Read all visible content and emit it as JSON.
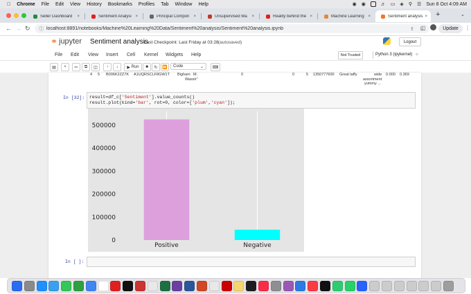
{
  "menubar": {
    "items": [
      "Chrome",
      "File",
      "Edit",
      "View",
      "History",
      "Bookmarks",
      "Profiles",
      "Tab",
      "Window",
      "Help"
    ],
    "clock": "Sun 8 Oct  4:09 AM"
  },
  "tabs": [
    {
      "title": "Seller Dashboard",
      "color": "#2b8a3e"
    },
    {
      "title": "Sentiment Analysi",
      "color": "#e02020"
    },
    {
      "title": "Principal Compon",
      "color": "#666666"
    },
    {
      "title": "Unsupervised Ma",
      "color": "#c0392b"
    },
    {
      "title": "Reality behind the",
      "color": "#e02020"
    },
    {
      "title": "Machine Learning",
      "color": "#e08a3c"
    },
    {
      "title": "Sentiment analysis",
      "color": "#f37626"
    }
  ],
  "address": {
    "url": "localhost:8891/notebooks/Machine%20Learning%20Data/Sentiment%20analysis/Sentiment%20analysis.ipynb",
    "update": "Update"
  },
  "jupyter": {
    "logo": "jupyter",
    "notebook_name": "Sentiment analysis",
    "checkpoint": "Last Checkpoint: Last Friday at 03:28",
    "autosave": "(autosaved)",
    "logout": "Logout",
    "trusted": "Not Trusted",
    "kernel": "Python 3 (ipykernel)",
    "menu": [
      "File",
      "Edit",
      "View",
      "Insert",
      "Cell",
      "Kernel",
      "Widgets",
      "Help"
    ],
    "run": "Run",
    "celltype": "Code"
  },
  "partial_row": {
    "index": "4",
    "col1": "5",
    "id": "B006K2ZZ7K",
    "user": "A1UQRSCLF8GW1T",
    "name1": "Bigham",
    "name2": "M.",
    "name3": "Wassir\"",
    "v1": "0",
    "v2": "0",
    "v3": "5",
    "time": "1350777600",
    "summary": "Great taffy",
    "text1": "wide",
    "text2": "assortment",
    "text3": "yummy ...",
    "n1": "0.000",
    "n2": "0.369"
  },
  "cell32": {
    "prompt": "In [32]:",
    "line1_a": "result=df_c[",
    "line1_s": "'Sentiment'",
    "line1_b": "].value_counts()",
    "line2_a": "result.plot(kind=",
    "line2_s1": "'bar'",
    "line2_b": ", rot=0, color=[",
    "line2_s2": "'plum'",
    "line2_c": ",",
    "line2_s3": "'cyan'",
    "line2_d": "]);"
  },
  "empty_cell": {
    "prompt": "In [ ]:"
  },
  "chart_data": {
    "type": "bar",
    "categories": [
      "Positive",
      "Negative"
    ],
    "values": [
      525000,
      45000
    ],
    "colors": [
      "#dda0dd",
      "#00ffff"
    ],
    "ylim": [
      0,
      560000
    ],
    "yticks": [
      0,
      100000,
      200000,
      300000,
      400000,
      500000
    ],
    "ytick_labels": [
      "0",
      "100000",
      "200000",
      "300000",
      "400000",
      "500000"
    ],
    "xlabel": "",
    "ylabel": "",
    "title": "",
    "grid": true,
    "background": "#e5e5e5"
  }
}
